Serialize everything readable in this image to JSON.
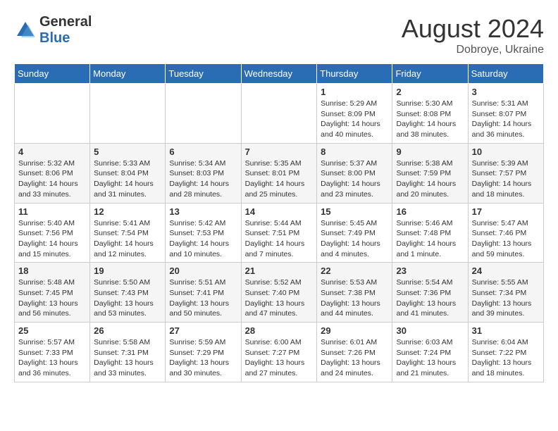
{
  "logo": {
    "general": "General",
    "blue": "Blue"
  },
  "header": {
    "month_year": "August 2024",
    "location": "Dobroye, Ukraine"
  },
  "weekdays": [
    "Sunday",
    "Monday",
    "Tuesday",
    "Wednesday",
    "Thursday",
    "Friday",
    "Saturday"
  ],
  "weeks": [
    [
      {
        "day": "",
        "info": ""
      },
      {
        "day": "",
        "info": ""
      },
      {
        "day": "",
        "info": ""
      },
      {
        "day": "",
        "info": ""
      },
      {
        "day": "1",
        "info": "Sunrise: 5:29 AM\nSunset: 8:09 PM\nDaylight: 14 hours\nand 40 minutes."
      },
      {
        "day": "2",
        "info": "Sunrise: 5:30 AM\nSunset: 8:08 PM\nDaylight: 14 hours\nand 38 minutes."
      },
      {
        "day": "3",
        "info": "Sunrise: 5:31 AM\nSunset: 8:07 PM\nDaylight: 14 hours\nand 36 minutes."
      }
    ],
    [
      {
        "day": "4",
        "info": "Sunrise: 5:32 AM\nSunset: 8:06 PM\nDaylight: 14 hours\nand 33 minutes."
      },
      {
        "day": "5",
        "info": "Sunrise: 5:33 AM\nSunset: 8:04 PM\nDaylight: 14 hours\nand 31 minutes."
      },
      {
        "day": "6",
        "info": "Sunrise: 5:34 AM\nSunset: 8:03 PM\nDaylight: 14 hours\nand 28 minutes."
      },
      {
        "day": "7",
        "info": "Sunrise: 5:35 AM\nSunset: 8:01 PM\nDaylight: 14 hours\nand 25 minutes."
      },
      {
        "day": "8",
        "info": "Sunrise: 5:37 AM\nSunset: 8:00 PM\nDaylight: 14 hours\nand 23 minutes."
      },
      {
        "day": "9",
        "info": "Sunrise: 5:38 AM\nSunset: 7:59 PM\nDaylight: 14 hours\nand 20 minutes."
      },
      {
        "day": "10",
        "info": "Sunrise: 5:39 AM\nSunset: 7:57 PM\nDaylight: 14 hours\nand 18 minutes."
      }
    ],
    [
      {
        "day": "11",
        "info": "Sunrise: 5:40 AM\nSunset: 7:56 PM\nDaylight: 14 hours\nand 15 minutes."
      },
      {
        "day": "12",
        "info": "Sunrise: 5:41 AM\nSunset: 7:54 PM\nDaylight: 14 hours\nand 12 minutes."
      },
      {
        "day": "13",
        "info": "Sunrise: 5:42 AM\nSunset: 7:53 PM\nDaylight: 14 hours\nand 10 minutes."
      },
      {
        "day": "14",
        "info": "Sunrise: 5:44 AM\nSunset: 7:51 PM\nDaylight: 14 hours\nand 7 minutes."
      },
      {
        "day": "15",
        "info": "Sunrise: 5:45 AM\nSunset: 7:49 PM\nDaylight: 14 hours\nand 4 minutes."
      },
      {
        "day": "16",
        "info": "Sunrise: 5:46 AM\nSunset: 7:48 PM\nDaylight: 14 hours\nand 1 minute."
      },
      {
        "day": "17",
        "info": "Sunrise: 5:47 AM\nSunset: 7:46 PM\nDaylight: 13 hours\nand 59 minutes."
      }
    ],
    [
      {
        "day": "18",
        "info": "Sunrise: 5:48 AM\nSunset: 7:45 PM\nDaylight: 13 hours\nand 56 minutes."
      },
      {
        "day": "19",
        "info": "Sunrise: 5:50 AM\nSunset: 7:43 PM\nDaylight: 13 hours\nand 53 minutes."
      },
      {
        "day": "20",
        "info": "Sunrise: 5:51 AM\nSunset: 7:41 PM\nDaylight: 13 hours\nand 50 minutes."
      },
      {
        "day": "21",
        "info": "Sunrise: 5:52 AM\nSunset: 7:40 PM\nDaylight: 13 hours\nand 47 minutes."
      },
      {
        "day": "22",
        "info": "Sunrise: 5:53 AM\nSunset: 7:38 PM\nDaylight: 13 hours\nand 44 minutes."
      },
      {
        "day": "23",
        "info": "Sunrise: 5:54 AM\nSunset: 7:36 PM\nDaylight: 13 hours\nand 41 minutes."
      },
      {
        "day": "24",
        "info": "Sunrise: 5:55 AM\nSunset: 7:34 PM\nDaylight: 13 hours\nand 39 minutes."
      }
    ],
    [
      {
        "day": "25",
        "info": "Sunrise: 5:57 AM\nSunset: 7:33 PM\nDaylight: 13 hours\nand 36 minutes."
      },
      {
        "day": "26",
        "info": "Sunrise: 5:58 AM\nSunset: 7:31 PM\nDaylight: 13 hours\nand 33 minutes."
      },
      {
        "day": "27",
        "info": "Sunrise: 5:59 AM\nSunset: 7:29 PM\nDaylight: 13 hours\nand 30 minutes."
      },
      {
        "day": "28",
        "info": "Sunrise: 6:00 AM\nSunset: 7:27 PM\nDaylight: 13 hours\nand 27 minutes."
      },
      {
        "day": "29",
        "info": "Sunrise: 6:01 AM\nSunset: 7:26 PM\nDaylight: 13 hours\nand 24 minutes."
      },
      {
        "day": "30",
        "info": "Sunrise: 6:03 AM\nSunset: 7:24 PM\nDaylight: 13 hours\nand 21 minutes."
      },
      {
        "day": "31",
        "info": "Sunrise: 6:04 AM\nSunset: 7:22 PM\nDaylight: 13 hours\nand 18 minutes."
      }
    ]
  ]
}
